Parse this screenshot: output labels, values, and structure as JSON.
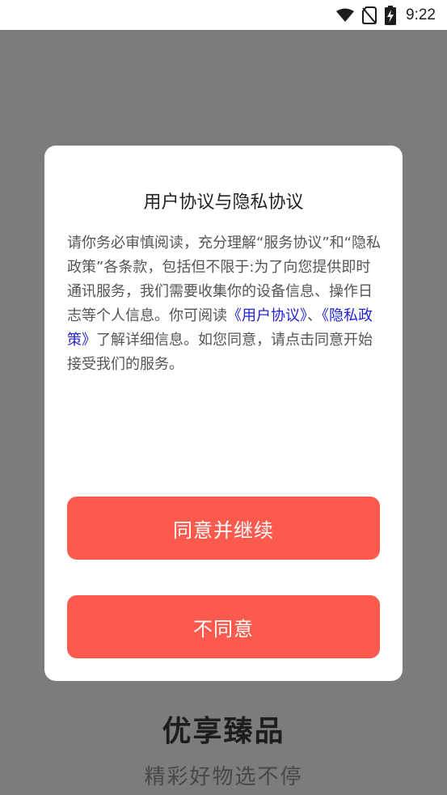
{
  "status_bar": {
    "time": "9:22",
    "icons": [
      "wifi-icon",
      "no-sim-icon",
      "battery-charging-icon"
    ]
  },
  "background": {
    "title": "优享臻品",
    "subtitle": "精彩好物选不停"
  },
  "dialog": {
    "title": "用户协议与隐私协议",
    "body_before": "请你务必审慎阅读，充分理解“服务协议”和“隐私政策”各条款，包括但不限于:为了向您提供即时通讯服务，我们需要收集你的设备信息、操作日志等个人信息。你可阅读",
    "link_user_agreement": "《用户协议》",
    "separator": "、",
    "link_privacy_policy": "《隐私政策》",
    "body_after": "了解详细信息。如您同意，请点击同意开始接受我们的服务。",
    "agree_label": "同意并继续",
    "disagree_label": "不同意"
  },
  "colors": {
    "accent": "#fd5a4e",
    "link": "#2323d6",
    "overlay": "#7e7b7e"
  }
}
